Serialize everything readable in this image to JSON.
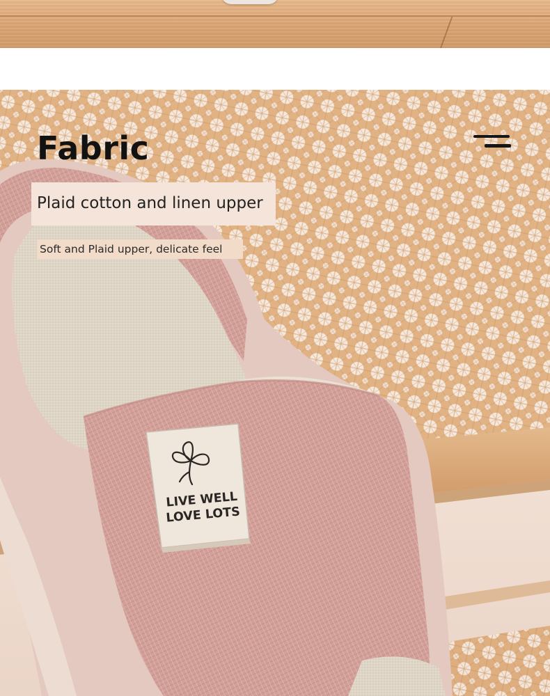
{
  "section": {
    "title": "Fabric",
    "subtitle": "Plaid cotton and linen upper",
    "caption": "Soft and Plaid upper, delicate feel"
  },
  "tag": {
    "line1": "LIVE WELL",
    "line2": "LOVE LOTS",
    "icon": "clover-icon"
  },
  "icons": {
    "menu": "menu-icon"
  },
  "colors": {
    "heading": "#121212",
    "subtitle_box": "#f4e4d9",
    "caption_box": "#f2dcc9",
    "slipper_pink": "#d4a29b",
    "rattan": "#d7a877",
    "wood": "#d9a474"
  }
}
